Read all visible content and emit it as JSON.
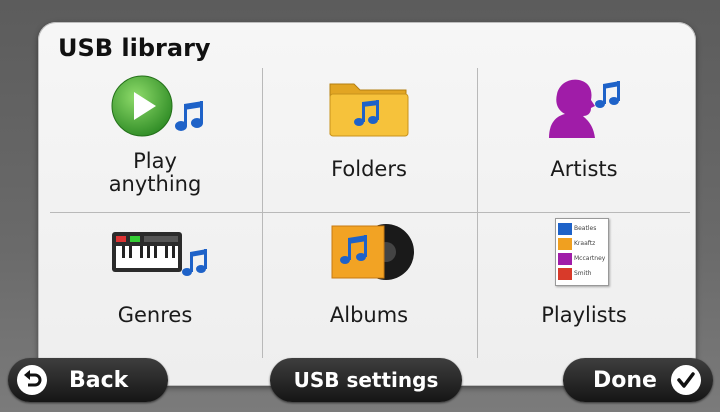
{
  "header": {
    "title": "USB library"
  },
  "grid": {
    "items": [
      {
        "label": "Play\nanything",
        "icon": "play-music-icon"
      },
      {
        "label": "Folders",
        "icon": "folder-music-icon"
      },
      {
        "label": "Artists",
        "icon": "artist-music-icon"
      },
      {
        "label": "Genres",
        "icon": "keyboard-music-icon"
      },
      {
        "label": "Albums",
        "icon": "album-music-icon"
      },
      {
        "label": "Playlists",
        "icon": "playlist-icon"
      }
    ],
    "playlist_icon_lines": [
      "Beatles",
      "Kraaftz",
      "Mccartney",
      "Smith"
    ]
  },
  "footer": {
    "back_label": "Back",
    "usb_settings_label": "USB settings",
    "done_label": "Done"
  },
  "colors": {
    "accent_green": "#3a9a2e",
    "note_blue": "#1e62c8",
    "artist_purple": "#a01ca8",
    "folder_yellow": "#f6c23b"
  }
}
